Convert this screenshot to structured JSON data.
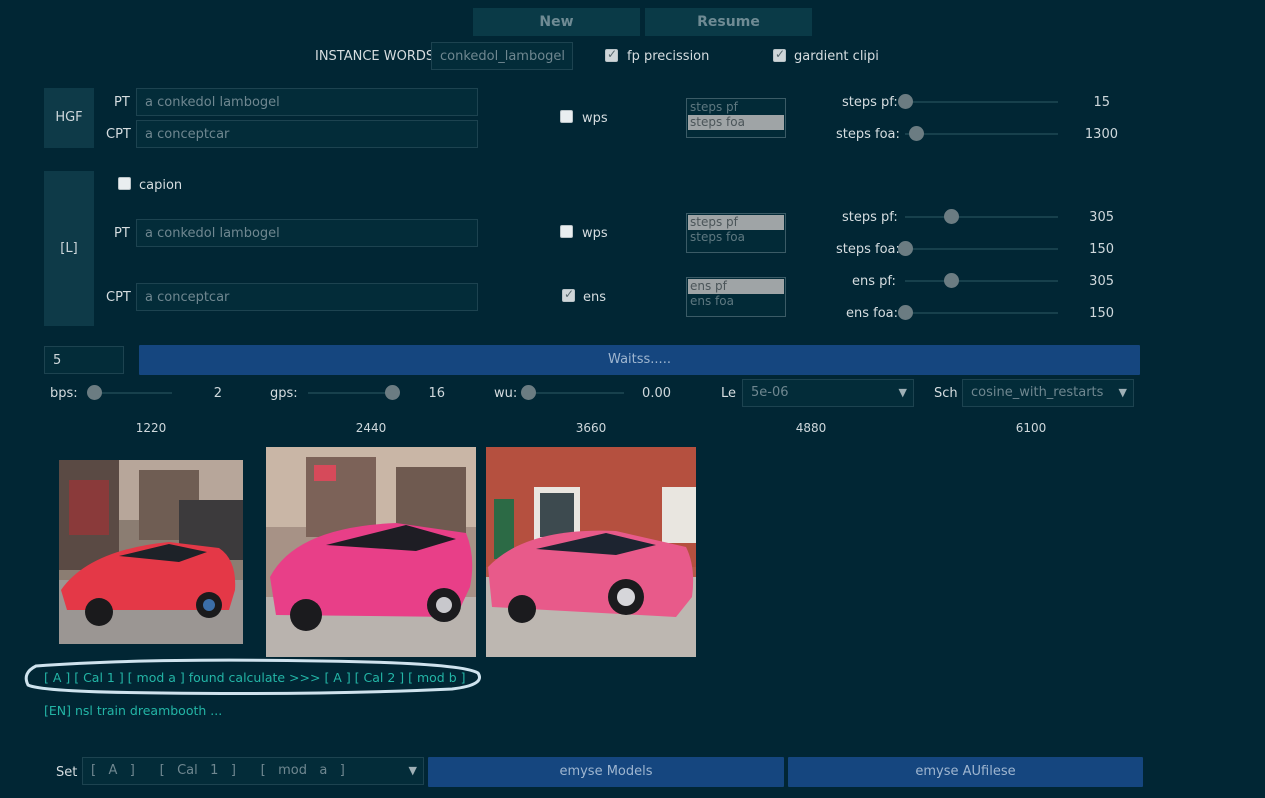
{
  "top_buttons": {
    "new_label": "New",
    "resume_label": "Resume"
  },
  "instance": {
    "label": "INSTANCE WORDS",
    "value": "conkedol_lambogel"
  },
  "options": {
    "fp_label": "fp precission",
    "fp_checked": true,
    "gc_label": "gardient clipi",
    "gc_checked": true
  },
  "hgf": {
    "side_label": "HGF",
    "pt_label": "PT",
    "pt_value": "a conkedol lambogel",
    "cpt_label": "CPT",
    "cpt_value": "a conceptcar",
    "wps_label": "wps",
    "list": [
      "steps pf",
      "steps foa"
    ],
    "list_selected": 1,
    "sliders": [
      {
        "label": "steps pf:",
        "value": "15",
        "fraction": 0.0
      },
      {
        "label": "steps foa:",
        "value": "1300",
        "fraction": 0.07
      }
    ]
  },
  "l": {
    "side_label": "[L]",
    "capion_label": "capion",
    "pt_label": "PT",
    "pt_value": "a conkedol lambogel",
    "cpt_label": "CPT",
    "cpt_value": "a conceptcar",
    "wps_label": "wps",
    "ens_label": "ens",
    "list1": [
      "steps pf",
      "steps foa"
    ],
    "list1_selected": 0,
    "list2": [
      "ens pf",
      "ens foa"
    ],
    "list2_selected": 0,
    "sliders": [
      {
        "label": "steps pf:",
        "value": "305",
        "fraction": 0.3
      },
      {
        "label": "steps foa:",
        "value": "150",
        "fraction": 0.0
      },
      {
        "label": "ens pf:",
        "value": "305",
        "fraction": 0.3
      },
      {
        "label": "ens foa:",
        "value": "150",
        "fraction": 0.0
      }
    ]
  },
  "run": {
    "count_value": "5",
    "button_label": "Waitss....."
  },
  "params": {
    "bps_label": "bps:",
    "bps_value": "2",
    "bps_fraction": 0.0,
    "gps_label": "gps:",
    "gps_value": "16",
    "gps_fraction": 1.0,
    "wu_label": "wu:",
    "wu_value": "0.00",
    "wu_fraction": 0.0,
    "le_label": "Le",
    "le_value": "5e-06",
    "sch_label": "Sch",
    "sch_value": "cosine_with_restarts"
  },
  "ticks": [
    "1220",
    "2440",
    "3660",
    "4880",
    "6100"
  ],
  "status_line": "[ A ]    [ Cal 1 ]    [ mod a ] found calculate >>> [ A ]    [ Cal 2 ]    [ mod b ]",
  "info_line": "[EN] nsl train dreambooth ...",
  "bottom": {
    "set_label": "Set",
    "set_value": "[   A   ]      [   Cal   1   ]      [   mod   a   ]",
    "models_label": "emyse Models",
    "files_label": "emyse AUfilese"
  },
  "colors": {
    "background": "#012634",
    "primary": "#15467f",
    "link": "#23b5a6"
  }
}
